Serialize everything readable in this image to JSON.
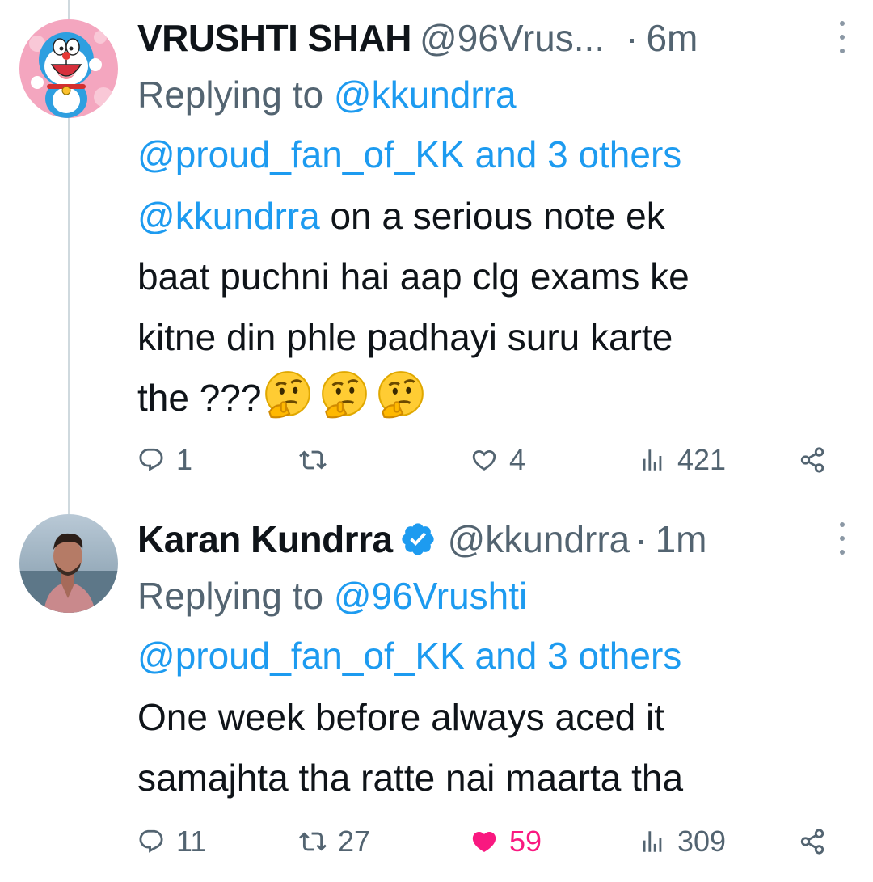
{
  "tweets": [
    {
      "author_name": "VRUSHTI SHAH",
      "handle": "@96Vrus...",
      "separator": "·",
      "time": "6m",
      "replying_prefix": "Replying to",
      "replying_to": "@kkundrra",
      "replying_rest": "@proud_fan_of_KK and 3 others",
      "mention": "@kkundrra",
      "text_1": " on a serious note ek",
      "text_2": "baat puchni hai aap clg exams ke",
      "text_3": "kitne din phle padhayi suru karte",
      "text_4": "the ???",
      "emoji_icon": "thinking-face-emoji",
      "replies": "1",
      "retweets": "",
      "likes": "4",
      "views": "421",
      "liked": false
    },
    {
      "author_name": "Karan Kundrra",
      "verified": true,
      "handle": "@kkundrra",
      "separator": "·",
      "time": "1m",
      "replying_prefix": "Replying to",
      "replying_to": "@96Vrushti",
      "replying_rest": "@proud_fan_of_KK and 3 others",
      "text_1": "One week before always aced it",
      "text_2": "samajhta tha ratte nai maarta tha",
      "replies": "11",
      "retweets": "27",
      "likes": "59",
      "views": "309",
      "liked": true
    }
  ],
  "icons": {
    "reply": "reply-icon",
    "retweet": "retweet-icon",
    "like": "heart-icon",
    "views": "views-icon",
    "share": "share-icon",
    "more": "more-options-icon",
    "verified": "verified-badge-icon"
  },
  "colors": {
    "link": "#1d9bf0",
    "secondary_text": "#536471",
    "like_active": "#f91880",
    "verified": "#1d9bf0",
    "thread_line": "#cfd9de"
  }
}
